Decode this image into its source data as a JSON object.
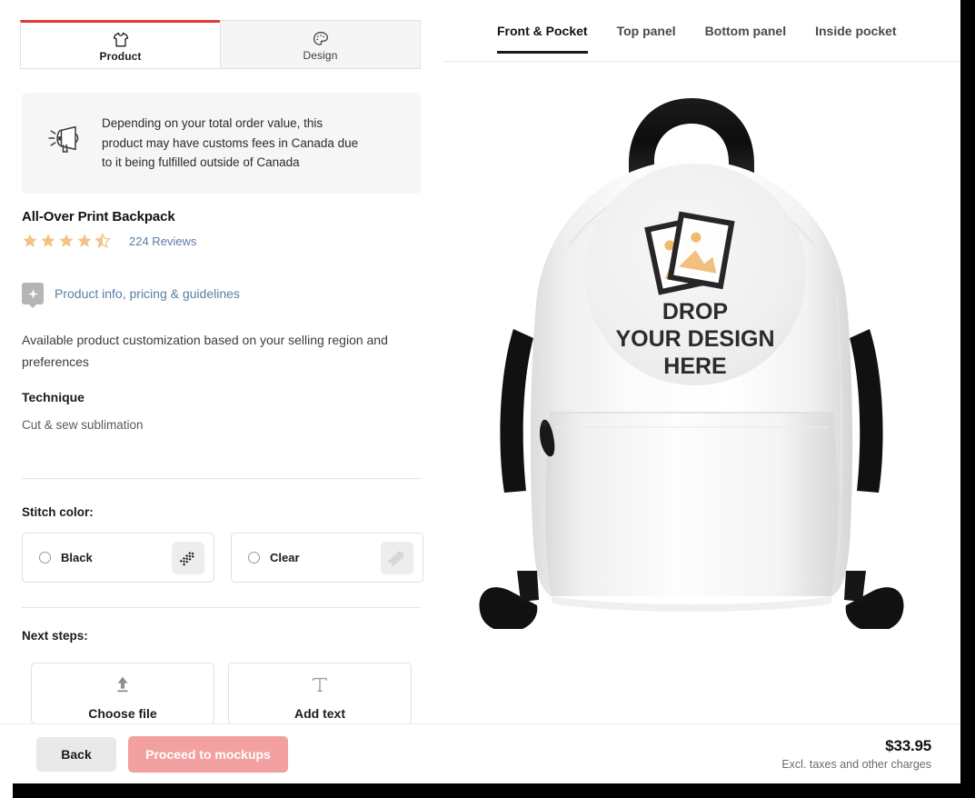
{
  "window": {
    "edge_color": "#000000"
  },
  "sidebar": {
    "tabs": [
      {
        "label": "Product",
        "icon": "tshirt-icon",
        "active": true
      },
      {
        "label": "Design",
        "icon": "palette-icon",
        "active": false
      }
    ],
    "notice": {
      "icon": "megaphone-icon",
      "text": "Depending on your total order value, this product may have customs fees in Canada due to it being fulfilled outside of Canada"
    },
    "product_title": "All-Over Print Backpack",
    "rating": {
      "stars_filled": 4.5,
      "stars_total": 5,
      "star_color": "#f2c385",
      "reviews_label": "224 Reviews"
    },
    "info_link": {
      "icon": "info-badge-icon",
      "label": "Product info, pricing & guidelines",
      "color": "#5b7ea6"
    },
    "description": "Available product customization based on your selling region and preferences",
    "technique": {
      "label": "Technique",
      "value": "Cut & sew sublimation"
    },
    "stitch": {
      "label": "Stitch color:",
      "options": [
        {
          "name": "Black",
          "selected": false,
          "swatch": "stitch-black-icon"
        },
        {
          "name": "Clear",
          "selected": false,
          "swatch": "stitch-clear-icon"
        }
      ]
    },
    "next_steps": {
      "label": "Next steps:",
      "options": [
        {
          "label": "Choose file",
          "icon": "upload-icon"
        },
        {
          "label": "Add text",
          "icon": "text-icon"
        }
      ]
    }
  },
  "preview": {
    "tabs": [
      {
        "label": "Front & Pocket",
        "active": true
      },
      {
        "label": "Top panel",
        "active": false
      },
      {
        "label": "Bottom panel",
        "active": false
      },
      {
        "label": "Inside pocket",
        "active": false
      }
    ],
    "mockup": {
      "product": "white-backpack-mockup",
      "placeholder_icon": "photos-icon",
      "placeholder_line1": "DROP",
      "placeholder_line2": "YOUR DESIGN",
      "placeholder_line3": "HERE"
    }
  },
  "bottombar": {
    "back_label": "Back",
    "proceed_label": "Proceed to mockups",
    "proceed_color": "#f2a0a0",
    "price": "$33.95",
    "price_note": "Excl. taxes and other charges"
  }
}
